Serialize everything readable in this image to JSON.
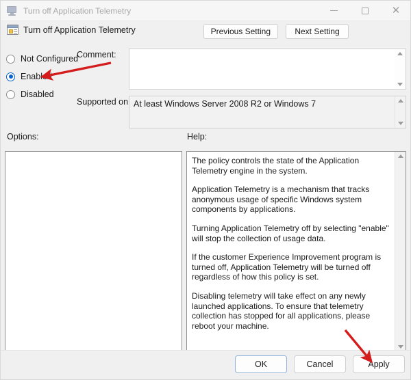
{
  "window": {
    "title": "Turn off Application Telemetry",
    "title_icon": "computer-monitor-icon",
    "controls": {
      "minimize": "minimize-icon",
      "maximize": "maximize-icon",
      "close": "close-icon"
    }
  },
  "header": {
    "icon": "policy-setting-icon",
    "title": "Turn off Application Telemetry",
    "previous_setting_label": "Previous Setting",
    "next_setting_label": "Next Setting"
  },
  "state_options": [
    {
      "label": "Not Configured",
      "selected": false
    },
    {
      "label": "Enabled",
      "selected": true
    },
    {
      "label": "Disabled",
      "selected": false
    }
  ],
  "comment": {
    "label": "Comment:",
    "value": "",
    "placeholder": ""
  },
  "supported_on": {
    "label": "Supported on:",
    "value": "At least Windows Server 2008 R2 or Windows 7"
  },
  "options": {
    "label": "Options:",
    "value": ""
  },
  "help": {
    "label": "Help:",
    "paragraphs": [
      "The policy controls the state of the Application Telemetry engine in the system.",
      "Application Telemetry is a mechanism that tracks anonymous usage of specific Windows system components by applications.",
      "Turning Application Telemetry off by selecting \"enable\" will stop the collection of usage data.",
      "If the customer Experience Improvement program is turned off, Application Telemetry will be turned off regardless of how this policy is set.",
      "Disabling telemetry will take effect on any newly launched applications. To ensure that telemetry collection has stopped for all applications, please reboot your machine."
    ]
  },
  "footer": {
    "ok_label": "OK",
    "cancel_label": "Cancel",
    "apply_label": "Apply"
  },
  "annotations": {
    "color": "#d51c1c",
    "arrows": [
      {
        "name": "arrow-pointing-to-enabled",
        "target": "Enabled"
      },
      {
        "name": "arrow-pointing-to-apply",
        "target": "Apply"
      }
    ]
  }
}
